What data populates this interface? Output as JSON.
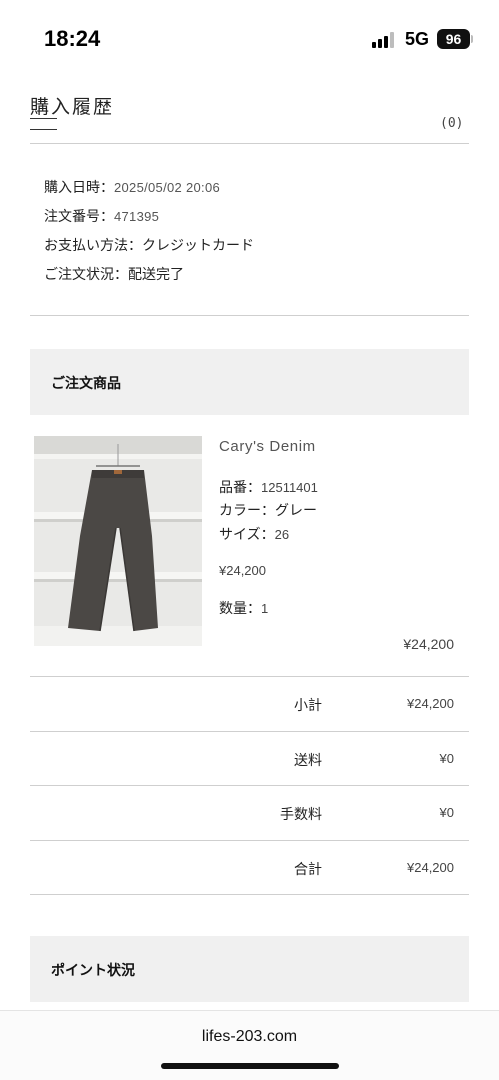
{
  "status_bar": {
    "time": "18:24",
    "network": "5G",
    "battery": "96"
  },
  "header": {
    "title": "購入履歴",
    "count": "(0)"
  },
  "order_info": {
    "date_label": "購入日時：",
    "date_value": "2025/05/02 20:06",
    "order_no_label": "注文番号：",
    "order_no_value": "471395",
    "payment": "お支払い方法：クレジットカード",
    "status": "ご注文状況：配送完了"
  },
  "items_section": {
    "title": "ご注文商品"
  },
  "product": {
    "name": "Cary's Denim",
    "sku_label": "品番：",
    "sku_value": "12511401",
    "color": "カラー：グレー",
    "size_label": "サイズ：",
    "size_value": "26",
    "unit_price": "¥24,200",
    "qty_label": "数量：",
    "qty_value": "1",
    "line_total": "¥24,200"
  },
  "totals": [
    {
      "label": "小計",
      "value": "¥24,200"
    },
    {
      "label": "送料",
      "value": "¥0"
    },
    {
      "label": "手数料",
      "value": "¥0"
    },
    {
      "label": "合計",
      "value": "¥24,200"
    }
  ],
  "points_section": {
    "title": "ポイント状況"
  },
  "browser": {
    "url": "lifes-203.com"
  },
  "icons": [
    "cellular-signal-icon",
    "battery-icon"
  ],
  "colors": {
    "section_bg": "#f0f0f0",
    "divider": "#cfcfcf",
    "text": "#222222"
  }
}
